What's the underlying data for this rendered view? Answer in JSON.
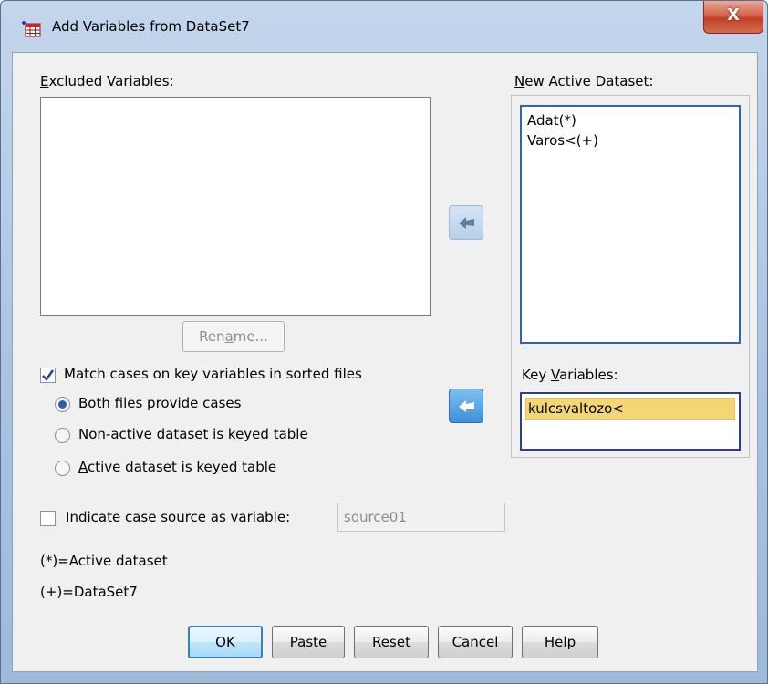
{
  "window": {
    "title": "Add Variables from DataSet7",
    "close_label": "X"
  },
  "excluded": {
    "label_pre": "",
    "label_u": "E",
    "label_post": "xcluded Variables:",
    "items": []
  },
  "rename_button": {
    "pre": "Ren",
    "u": "a",
    "post": "me..."
  },
  "new_active": {
    "label_pre": "",
    "label_u": "N",
    "label_post": "ew Active Dataset:",
    "items": [
      "Adat(*)",
      "Varos<(+)"
    ]
  },
  "key_vars": {
    "label_pre": "Key ",
    "label_u": "V",
    "label_post": "ariables:",
    "items": [
      "kulcsvaltozo<"
    ]
  },
  "match_checkbox": {
    "label": "Match cases on key variables in sorted files",
    "checked": true
  },
  "radios": [
    {
      "pre": "",
      "u": "B",
      "post": "oth files provide cases",
      "selected": true
    },
    {
      "pre": "Non-active dataset is ",
      "u": "k",
      "post": "eyed table",
      "selected": false
    },
    {
      "pre": "",
      "u": "A",
      "post": "ctive dataset is keyed table",
      "selected": false
    }
  ],
  "indicate_checkbox": {
    "pre": "",
    "u": "I",
    "post": "ndicate case source as variable:",
    "checked": false
  },
  "source_field": {
    "value": "source01"
  },
  "legend": {
    "active": "(*)=Active dataset",
    "other": "(+)=DataSet7"
  },
  "buttons": {
    "ok": "OK",
    "paste": {
      "pre": "",
      "u": "P",
      "post": "aste"
    },
    "reset": {
      "pre": "",
      "u": "R",
      "post": "eset"
    },
    "cancel": "Cancel",
    "help": "Help"
  },
  "colors": {
    "selection": "#f3d775",
    "focus_border": "#3460b8",
    "arrow_active": "#3f8fd8"
  }
}
